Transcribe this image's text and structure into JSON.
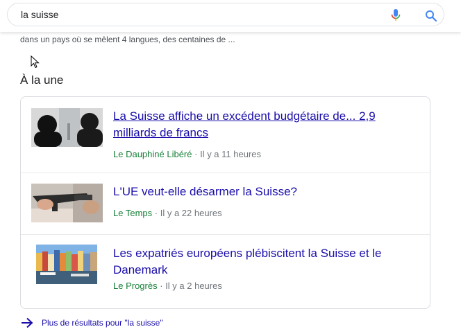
{
  "search": {
    "query": "la suisse",
    "mic_icon": "mic-icon",
    "search_icon": "search-icon"
  },
  "snippet": "dans un pays où se mêlent 4 langues, des centaines de ...",
  "section_title": "À la une",
  "stories": [
    {
      "title": "La Suisse affiche un excédent budgétaire de... 2,9 milliards de francs",
      "source": "Le Dauphiné Libéré",
      "separator": "·",
      "time": "Il y a 11 heures"
    },
    {
      "title": "L'UE veut-elle désarmer la Suisse?",
      "source": "Le Temps",
      "separator": "·",
      "time": "Il y a 22 heures"
    },
    {
      "title": "Les expatriés européens plébiscitent la Suisse et le Danemark",
      "source": "Le Progrès",
      "separator": "·",
      "time": "Il y a 2 heures"
    }
  ],
  "more_results": "Plus de résultats pour \"la suisse\"",
  "colors": {
    "link": "#1a0dab",
    "source": "#188038",
    "meta": "#70757a",
    "border": "#dadce0"
  }
}
